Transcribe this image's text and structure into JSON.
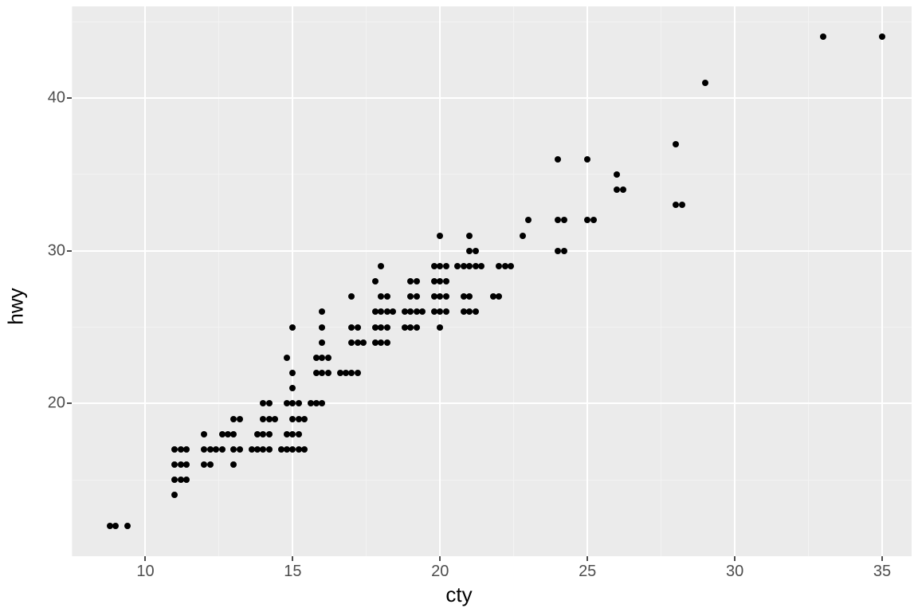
{
  "chart_data": {
    "type": "scatter",
    "xlabel": "cty",
    "ylabel": "hwy",
    "title": "",
    "xlim": [
      7.5,
      36
    ],
    "ylim": [
      10,
      46
    ],
    "x_breaks": [
      10,
      15,
      20,
      25,
      30,
      35
    ],
    "y_breaks": [
      20,
      30,
      40
    ],
    "x_minor": [
      7.5,
      12.5,
      17.5,
      22.5,
      27.5,
      32.5
    ],
    "y_minor": [
      15,
      25,
      35,
      45
    ],
    "series": [
      {
        "name": "points",
        "data": [
          [
            8.8,
            12
          ],
          [
            9.0,
            12
          ],
          [
            9.4,
            12
          ],
          [
            11.0,
            14
          ],
          [
            11.0,
            15
          ],
          [
            11.2,
            15
          ],
          [
            11.4,
            15
          ],
          [
            11.0,
            16
          ],
          [
            11.2,
            16
          ],
          [
            11.4,
            16
          ],
          [
            11.0,
            17
          ],
          [
            11.2,
            17
          ],
          [
            11.4,
            17
          ],
          [
            12.0,
            16
          ],
          [
            12.2,
            16
          ],
          [
            12.0,
            17
          ],
          [
            12.2,
            17
          ],
          [
            12.4,
            17
          ],
          [
            12.0,
            18
          ],
          [
            12.6,
            17
          ],
          [
            13.0,
            17
          ],
          [
            13.2,
            17
          ],
          [
            12.6,
            18
          ],
          [
            12.8,
            18
          ],
          [
            13.0,
            16
          ],
          [
            13.0,
            18
          ],
          [
            13.0,
            19
          ],
          [
            13.2,
            19
          ],
          [
            13.6,
            17
          ],
          [
            13.8,
            17
          ],
          [
            14.0,
            17
          ],
          [
            14.2,
            17
          ],
          [
            13.8,
            18
          ],
          [
            14.0,
            18
          ],
          [
            14.2,
            18
          ],
          [
            14.0,
            19
          ],
          [
            14.2,
            19
          ],
          [
            14.4,
            19
          ],
          [
            14.0,
            20
          ],
          [
            14.2,
            20
          ],
          [
            14.6,
            17
          ],
          [
            14.8,
            17
          ],
          [
            15.0,
            17
          ],
          [
            15.2,
            17
          ],
          [
            15.4,
            17
          ],
          [
            14.8,
            18
          ],
          [
            15.0,
            18
          ],
          [
            15.2,
            18
          ],
          [
            15.0,
            19
          ],
          [
            15.2,
            19
          ],
          [
            15.4,
            19
          ],
          [
            14.8,
            20
          ],
          [
            15.0,
            20
          ],
          [
            15.2,
            20
          ],
          [
            15.0,
            21
          ],
          [
            15.0,
            22
          ],
          [
            14.8,
            23
          ],
          [
            15.0,
            25
          ],
          [
            15.6,
            20
          ],
          [
            15.8,
            20
          ],
          [
            16.0,
            20
          ],
          [
            15.8,
            22
          ],
          [
            16.0,
            22
          ],
          [
            16.2,
            22
          ],
          [
            15.8,
            23
          ],
          [
            16.0,
            23
          ],
          [
            16.2,
            23
          ],
          [
            16.0,
            24
          ],
          [
            16.0,
            25
          ],
          [
            16.0,
            26
          ],
          [
            16.6,
            22
          ],
          [
            16.8,
            22
          ],
          [
            17.0,
            22
          ],
          [
            17.2,
            22
          ],
          [
            17.0,
            24
          ],
          [
            17.2,
            24
          ],
          [
            17.4,
            24
          ],
          [
            17.0,
            25
          ],
          [
            17.2,
            25
          ],
          [
            17.0,
            27
          ],
          [
            17.8,
            24
          ],
          [
            18.0,
            24
          ],
          [
            18.2,
            24
          ],
          [
            17.8,
            25
          ],
          [
            18.0,
            25
          ],
          [
            18.2,
            25
          ],
          [
            17.8,
            26
          ],
          [
            18.0,
            26
          ],
          [
            18.2,
            26
          ],
          [
            18.4,
            26
          ],
          [
            18.0,
            27
          ],
          [
            18.2,
            27
          ],
          [
            17.8,
            28
          ],
          [
            18.0,
            29
          ],
          [
            18.8,
            25
          ],
          [
            19.0,
            25
          ],
          [
            19.2,
            25
          ],
          [
            18.8,
            26
          ],
          [
            19.0,
            26
          ],
          [
            19.2,
            26
          ],
          [
            19.4,
            26
          ],
          [
            19.0,
            27
          ],
          [
            19.2,
            27
          ],
          [
            19.0,
            28
          ],
          [
            19.2,
            28
          ],
          [
            19.8,
            26
          ],
          [
            20.0,
            26
          ],
          [
            20.2,
            26
          ],
          [
            19.8,
            27
          ],
          [
            20.0,
            27
          ],
          [
            20.2,
            27
          ],
          [
            19.8,
            28
          ],
          [
            20.0,
            28
          ],
          [
            20.2,
            28
          ],
          [
            19.8,
            29
          ],
          [
            20.0,
            29
          ],
          [
            20.2,
            29
          ],
          [
            20.0,
            25
          ],
          [
            20.0,
            31
          ],
          [
            20.8,
            26
          ],
          [
            21.0,
            26
          ],
          [
            21.2,
            26
          ],
          [
            20.8,
            27
          ],
          [
            21.0,
            27
          ],
          [
            20.6,
            29
          ],
          [
            20.8,
            29
          ],
          [
            21.0,
            29
          ],
          [
            21.2,
            29
          ],
          [
            21.4,
            29
          ],
          [
            21.0,
            30
          ],
          [
            21.2,
            30
          ],
          [
            21.0,
            31
          ],
          [
            21.8,
            27
          ],
          [
            22.0,
            27
          ],
          [
            22.0,
            29
          ],
          [
            22.2,
            29
          ],
          [
            22.4,
            29
          ],
          [
            22.8,
            31
          ],
          [
            23.0,
            32
          ],
          [
            24.0,
            30
          ],
          [
            24.2,
            30
          ],
          [
            24.0,
            32
          ],
          [
            24.2,
            32
          ],
          [
            24.0,
            36
          ],
          [
            25.0,
            32
          ],
          [
            25.2,
            32
          ],
          [
            25.0,
            36
          ],
          [
            26.0,
            34
          ],
          [
            26.2,
            34
          ],
          [
            26.0,
            35
          ],
          [
            28.0,
            33
          ],
          [
            28.2,
            33
          ],
          [
            28.0,
            37
          ],
          [
            29.0,
            41
          ],
          [
            33.0,
            44
          ],
          [
            35.0,
            44
          ]
        ]
      }
    ]
  }
}
